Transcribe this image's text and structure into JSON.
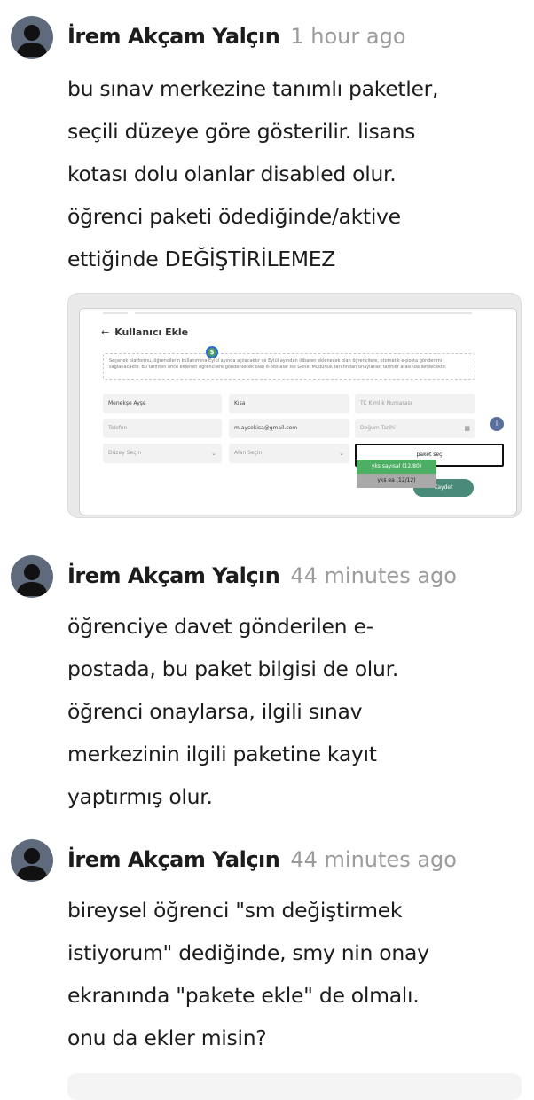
{
  "comments": [
    {
      "author": "İrem Akçam Yalçın",
      "time": "1 hour ago",
      "lines": [
        "bu sınav merkezine tanımlı paketler,",
        "seçili düzeye göre gösterilir. lisans",
        "kotası dolu olanlar disabled olur.",
        "öğrenci paketi ödediğinde/aktive",
        "ettiğinde DEĞİŞTİRİLEMEZ"
      ]
    },
    {
      "author": "İrem Akçam Yalçın",
      "time": "44 minutes ago",
      "lines": [
        "öğrenciye davet gönderilen e-",
        "postada, bu paket bilgisi de olur.",
        "öğrenci onaylarsa, ilgili sınav",
        "merkezinin ilgili paketine kayıt",
        "yaptırmış olur."
      ]
    },
    {
      "author": "İrem Akçam Yalçın",
      "time": "44 minutes ago",
      "lines": [
        "bireysel öğrenci \"sm değiştirmek",
        "istiyorum\" dediğinde, smy nin onay",
        "ekranında \"pakete ekle\" de olmalı.",
        "onu da ekler misin?"
      ]
    }
  ],
  "attachment": {
    "title": "Kullanıcı Ekle",
    "back_arrow": "←",
    "badge": "$",
    "info_text": "Seçenek platformu, öğrencilerin kullanımına Eylül ayında açılacaktır ve Eylül ayından itibaren eklenecek olan öğrencilere, otomatik e-posta gönderimi sağlanacaktır. Bu tarihten önce eklenen öğrencilere gönderilecek olan e-postalar ise Genel Müdürlük tarafından onaylanan tarihler arasında iletilecektir.",
    "fields": {
      "first_name": "Menekşe Ayşe",
      "last_name": "Kısa",
      "tc_placeholder": "TC Kimlik Numarası",
      "phone_placeholder": "Telefon",
      "email": "m.aysekisa@gmail.com",
      "birth_placeholder": "Doğum Tarihi",
      "level_placeholder": "Düzey Seçin",
      "area_placeholder": "Alan Seçin",
      "package_placeholder": "paket seç"
    },
    "dropdown_options": [
      {
        "label": "yks sayısal (12/80)",
        "state": "enabled"
      },
      {
        "label": "yks ea (12/12)",
        "state": "disabled"
      }
    ],
    "info_icon": "i",
    "save_label": "Kaydet",
    "colors": {
      "option_enabled": "#4caf63",
      "option_disabled": "#a9a9a9",
      "save": "#4a8a78"
    }
  }
}
